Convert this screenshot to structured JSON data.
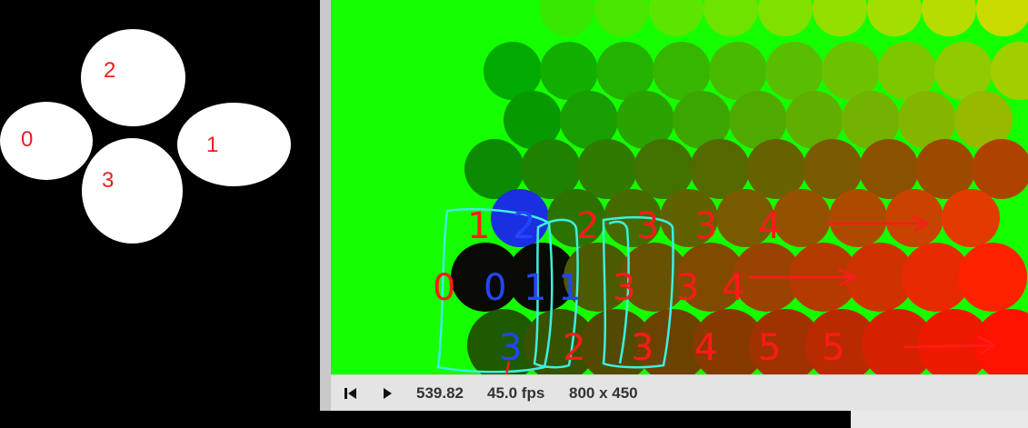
{
  "left_panel": {
    "labels": [
      "0",
      "1",
      "2",
      "3"
    ]
  },
  "controls": {
    "restart_icon": "skip-back-icon",
    "play_icon": "play-icon",
    "time": "539.82",
    "fps": "45.0 fps",
    "resolution": "800 x 450"
  },
  "annotations": {
    "row1": [
      "1",
      "2",
      "2",
      "3",
      "3",
      "4"
    ],
    "row2": [
      "0",
      "0",
      "1",
      "1",
      "3",
      "3",
      "4"
    ],
    "row3": [
      "3",
      "2",
      "3",
      "4",
      "5",
      "5"
    ],
    "colors": {
      "red": "#ff1a1a",
      "blue": "#2246ff",
      "cyan": "#3cf0e0"
    }
  }
}
